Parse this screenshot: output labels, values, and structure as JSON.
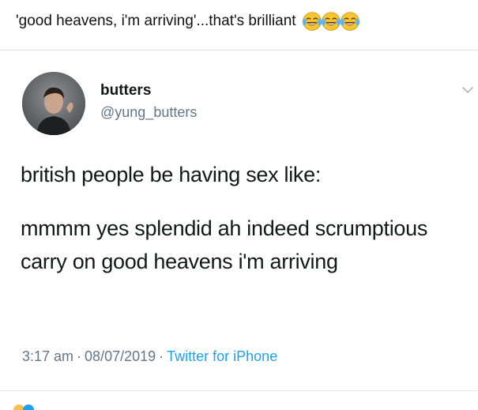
{
  "caption": {
    "text": "'good heavens, i'm arriving'...that's brilliant",
    "emoji_icons": [
      "face-with-tears-of-joy-icon",
      "face-with-tears-of-joy-icon",
      "face-with-tears-of-joy-icon"
    ]
  },
  "tweet": {
    "author_name": "butters",
    "author_handle": "@yung_butters",
    "text_line1": "british people be having sex like:",
    "text_paragraph2": "mmmm yes splendid ah indeed scrumptious carry on good heavens i'm arriving",
    "time": "3:17 am",
    "date": "08/07/2019",
    "source": "Twitter for iPhone",
    "separator": "·"
  },
  "colors": {
    "link_blue": "#1da1f2",
    "muted_gray": "#657786",
    "text_dark": "#14171a",
    "divider": "#e1e8ed"
  }
}
